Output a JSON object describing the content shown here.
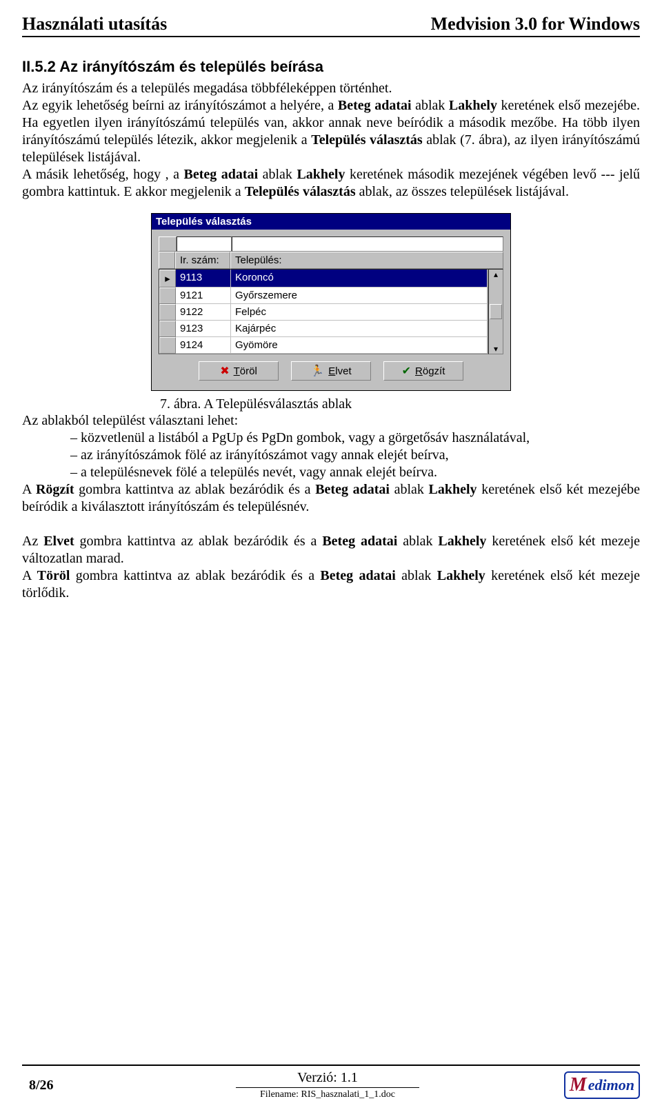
{
  "header": {
    "left": "Használati utasítás",
    "right": "Medvision 3.0 for Windows"
  },
  "section_title": "II.5.2 Az irányítószám és település beírása",
  "para1_a": "Az irányítószám és a település megadása többféleképpen történhet.",
  "para1_b_pre": "Az egyik lehetőség beírni az irányítószámot a helyére, a ",
  "bold_beteg1": "Beteg adatai",
  "para1_b_mid": " ablak ",
  "bold_lak1": "Lakhely",
  "para1_b_post": " keretének első mezejébe. Ha egyetlen ilyen irányítószámú település van, akkor annak neve beíródik a második mezőbe. Ha több ilyen irányítószámú település létezik, akkor megjelenik a ",
  "bold_telval1": "Település választás",
  "para1_c": " ablak (7. ábra), az ilyen irányítószámú települések listájával.",
  "para1_d_pre": "A másik lehetőség, hogy , a ",
  "bold_beteg2": "Beteg adatai",
  "para1_d_mid": " ablak ",
  "bold_lak2": "Lakhely",
  "para1_d_post": " keretének második mezejének végében levő --- jelű gombra kattintuk. E akkor megjelenik a ",
  "bold_telval2": "Település választás",
  "para1_e": " ablak, az összes települések listájával.",
  "dialog": {
    "title": "Település választás",
    "col_code": "Ir. szám:",
    "col_name": "Település:",
    "rows": [
      {
        "code": "9113",
        "name": "Koroncó",
        "sel": true
      },
      {
        "code": "9121",
        "name": "Győrszemere",
        "sel": false
      },
      {
        "code": "9122",
        "name": "Felpéc",
        "sel": false
      },
      {
        "code": "9123",
        "name": "Kajárpéc",
        "sel": false
      },
      {
        "code": "9124",
        "name": "Gyömöre",
        "sel": false
      }
    ],
    "buttons": {
      "torol": "Töröl",
      "elvet": "Elvet",
      "rogzit": "Rögzít"
    }
  },
  "caption": "7. ábra. A Településválasztás ablak",
  "after1": "Az ablakból települést választani lehet:",
  "bullets": [
    "közvetlenül a listából a PgUp és PgDn gombok, vagy a görgetősáv használatával,",
    "az irányítószámok fölé az irányítószámot vagy annak elejét beírva,",
    "a településnevek fölé a település nevét, vagy annak elejét beírva."
  ],
  "after2_a": "A ",
  "bold_rogzit": "Rögzít",
  "after2_b": " gombra kattintva az ablak bezáródik és a ",
  "bold_beteg3": "Beteg adatai",
  "after2_c": " ablak ",
  "bold_lak3": "Lakhely",
  "after2_d": " keretének első két mezejébe beíródik a kiválasztott irányítószám és településnév.",
  "after3_a": "Az ",
  "bold_elvet": "Elvet",
  "after3_b": " gombra kattintva az ablak bezáródik és a ",
  "bold_beteg4": "Beteg adatai",
  "after3_c": " ablak ",
  "bold_lak4": "Lakhely",
  "after3_d": " keretének első két mezeje változatlan marad.",
  "after4_a": "A ",
  "bold_torol": "Töröl",
  "after4_b": " gombra kattintva az ablak bezáródik és a ",
  "bold_beteg5": "Beteg adatai",
  "after4_c": " ablak ",
  "bold_lak5": "Lakhely",
  "after4_d": " keretének első két mezeje törlődik.",
  "footer": {
    "page": "8/26",
    "version": "Verzió: 1.1",
    "filename": "Filename: RIS_hasznalati_1_1.doc",
    "logo": "edimon"
  }
}
